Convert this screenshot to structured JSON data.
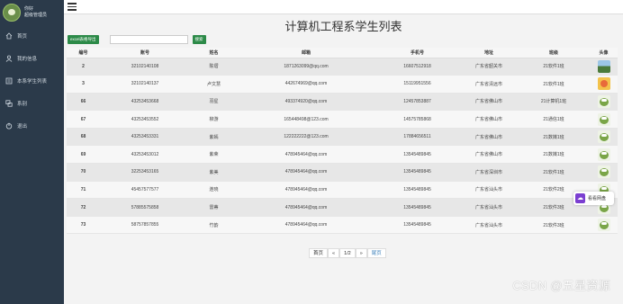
{
  "sidebar": {
    "greeting": "你好",
    "username": "超级管理员",
    "items": [
      {
        "label": "首页",
        "icon": "home-icon"
      },
      {
        "label": "我的信息",
        "icon": "user-icon"
      },
      {
        "label": "本系学生列表",
        "icon": "list-icon"
      },
      {
        "label": "系别",
        "icon": "network-icon"
      },
      {
        "label": "退出",
        "icon": "logout-icon"
      }
    ],
    "colors": {
      "background": "#2b3a4a",
      "text": "#cfd8e0"
    }
  },
  "page": {
    "title": "计算机工程系学生列表"
  },
  "toolbar": {
    "export_label": "excel表格导出",
    "search_placeholder": "",
    "search_label": "搜索"
  },
  "table": {
    "headers": [
      "编号",
      "账号",
      "姓名",
      "邮箱",
      "手机号",
      "地址",
      "班级",
      "头像"
    ],
    "rows": [
      {
        "id": "2",
        "account": "32102140108",
        "name": "陈熠",
        "email": "1871263099@qq.com",
        "phone": "16607512918",
        "address": "广东省韶关市",
        "class": "21软件1班",
        "avatar": "landscape"
      },
      {
        "id": "3",
        "account": "32102140137",
        "name": "卢文慧",
        "email": "442674969@qq.com",
        "phone": "15119951556",
        "address": "广东省清远市",
        "class": "21软件1班",
        "avatar": "cartoon"
      },
      {
        "id": "66",
        "account": "43253453668",
        "name": "羽星",
        "email": "493374920@qq.com",
        "phone": "12457853887",
        "address": "广东省佛山市",
        "class": "21计算机1班",
        "avatar": "frog"
      },
      {
        "id": "67",
        "account": "43253453552",
        "name": "柳游",
        "email": "165448498@123.com",
        "phone": "14575785868",
        "address": "广东省佛山市",
        "class": "21通信1班",
        "avatar": "frog"
      },
      {
        "id": "68",
        "account": "43253453331",
        "name": "紫嫣",
        "email": "122222222@123.com",
        "phone": "17884656511",
        "address": "广东省佛山市",
        "class": "21数媒1班",
        "avatar": "frog"
      },
      {
        "id": "69",
        "account": "43253453012",
        "name": "紫荣",
        "email": "478945464@qq.com",
        "phone": "13545489845",
        "address": "广东省佛山市",
        "class": "21数媒1班",
        "avatar": "frog"
      },
      {
        "id": "70",
        "account": "32253453165",
        "name": "紫美",
        "email": "478945464@qq.com",
        "phone": "13545489845",
        "address": "广东省深圳市",
        "class": "21软件1班",
        "avatar": "frog"
      },
      {
        "id": "71",
        "account": "45457577577",
        "name": "连晓",
        "email": "478945464@qq.com",
        "phone": "13545489845",
        "address": "广东省汕头市",
        "class": "21软件2班",
        "avatar": "frog"
      },
      {
        "id": "72",
        "account": "57885575858",
        "name": "雷蒂",
        "email": "478945464@qq.com",
        "phone": "13545489845",
        "address": "广东省汕头市",
        "class": "21软件3班",
        "avatar": "frog"
      },
      {
        "id": "73",
        "account": "58757857855",
        "name": "竹韵",
        "email": "478945464@qq.com",
        "phone": "13545489845",
        "address": "广东省汕头市",
        "class": "21软件3班",
        "avatar": "frog"
      }
    ]
  },
  "pagination": {
    "first": "首页",
    "prev": "«",
    "info": "1/2",
    "next": "»",
    "last": "尾页"
  },
  "widget": {
    "label": "看看网盘",
    "icon": "cloud-drive-icon"
  },
  "watermark": "CSDN @五星资源",
  "colors": {
    "accent_green": "#2c8a48",
    "link_blue": "#337ab7"
  }
}
